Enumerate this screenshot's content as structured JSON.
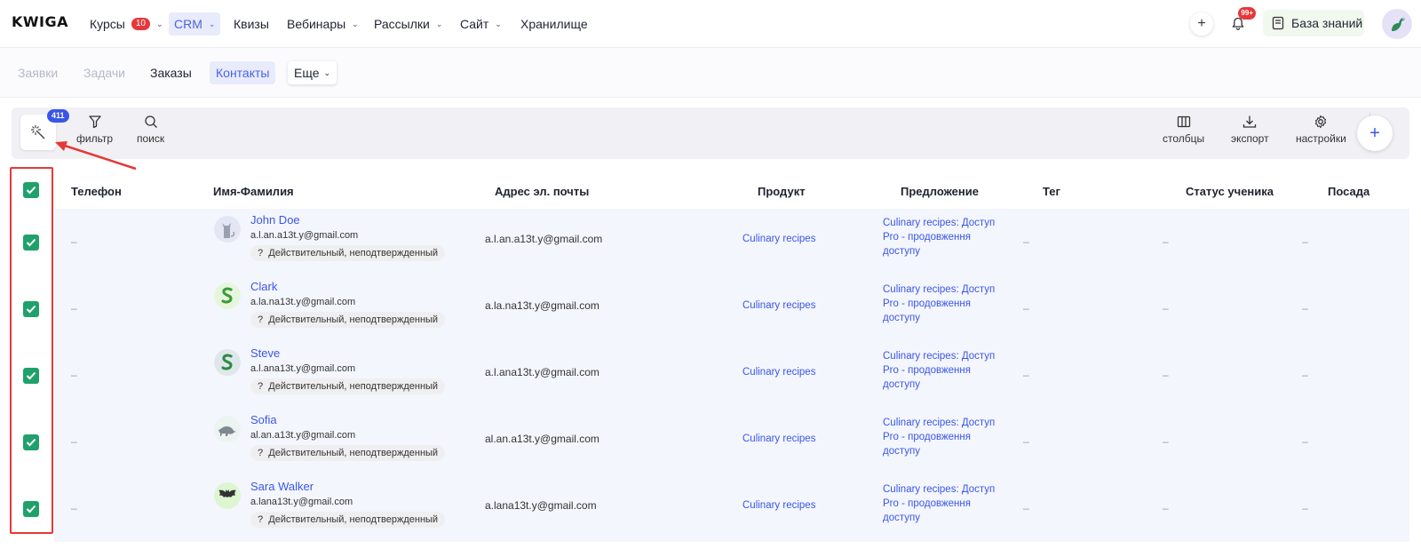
{
  "app": {
    "logo": "KWIGA"
  },
  "topnav": {
    "items": [
      {
        "label": "Курсы",
        "badge": "10"
      },
      {
        "label": "CRM"
      },
      {
        "label": "Квизы"
      },
      {
        "label": "Вебинары"
      },
      {
        "label": "Рассылки"
      },
      {
        "label": "Сайт"
      },
      {
        "label": "Хранилище"
      }
    ],
    "bell_badge": "99+",
    "knowledge_base": "База знаний"
  },
  "subnav": {
    "items": [
      "Заявки",
      "Задачи",
      "Заказы",
      "Контакты"
    ],
    "more": "Еще"
  },
  "toolbar": {
    "selected_count": "411",
    "filter": "фильтр",
    "search": "поиск",
    "columns": "столбцы",
    "export": "экспорт",
    "settings": "настройки"
  },
  "table": {
    "headers": [
      "Телефон",
      "Имя-Фамилия",
      "Адрес эл. почты",
      "Продукт",
      "Предложение",
      "Тег",
      "Статус ученика",
      "Посада"
    ],
    "rows": [
      {
        "phone": "–",
        "name": "John Doe",
        "sub_email": "a.l.an.a13t.y@gmail.com",
        "status": "Действительный, неподтвержденный",
        "email": "a.l.an.a13t.y@gmail.com",
        "product": "Culinary recipes",
        "offer_1": "Culinary recipes: Доступ",
        "offer_2": "Pro - продовження",
        "offer_3": "доступу",
        "tag": "–",
        "student_status": "–",
        "position": "–",
        "status_icon": "?"
      },
      {
        "phone": "–",
        "name": "Clark",
        "sub_email": "a.la.na13t.y@gmail.com",
        "status": "Действительный, неподтвержденный",
        "email": "a.la.na13t.y@gmail.com",
        "product": "Culinary recipes",
        "offer_1": "Culinary recipes: Доступ",
        "offer_2": "Pro - продовження",
        "offer_3": "доступу",
        "tag": "–",
        "student_status": "–",
        "position": "–",
        "status_icon": "?"
      },
      {
        "phone": "–",
        "name": "Steve",
        "sub_email": "a.l.ana13t.y@gmail.com",
        "status": "Действительный, неподтвержденный",
        "email": "a.l.ana13t.y@gmail.com",
        "product": "Culinary recipes",
        "offer_1": "Culinary recipes: Доступ",
        "offer_2": "Pro - продовження",
        "offer_3": "доступу",
        "tag": "–",
        "student_status": "–",
        "position": "–",
        "status_icon": "?"
      },
      {
        "phone": "–",
        "name": "Sofia",
        "sub_email": "al.an.a13t.y@gmail.com",
        "status": "Действительный, неподтвержденный",
        "email": "al.an.a13t.y@gmail.com",
        "product": "Culinary recipes",
        "offer_1": "Culinary recipes: Доступ",
        "offer_2": "Pro - продовження",
        "offer_3": "доступу",
        "tag": "–",
        "student_status": "–",
        "position": "–",
        "status_icon": "?"
      },
      {
        "phone": "–",
        "name": "Sara Walker",
        "sub_email": "a.lana13t.y@gmail.com",
        "status": "Действительный, неподтвержденный",
        "email": "a.lana13t.y@gmail.com",
        "product": "Culinary recipes",
        "offer_1": "Culinary recipes: Доступ",
        "offer_2": "Pro - продовження",
        "offer_3": "доступу",
        "tag": "–",
        "student_status": "–",
        "position": "–",
        "status_icon": "?"
      }
    ]
  },
  "colors": {
    "accent": "#3a56e8",
    "checkbox": "#20a16b",
    "highlight": "#e53935",
    "row_bg": "#f4f6fd"
  },
  "icons": [
    "magic-wand-icon",
    "filter-icon",
    "search-icon",
    "columns-icon",
    "download-icon",
    "gear-icon",
    "plus-icon",
    "bell-icon",
    "book-icon",
    "check-icon",
    "chevron-down-icon"
  ]
}
